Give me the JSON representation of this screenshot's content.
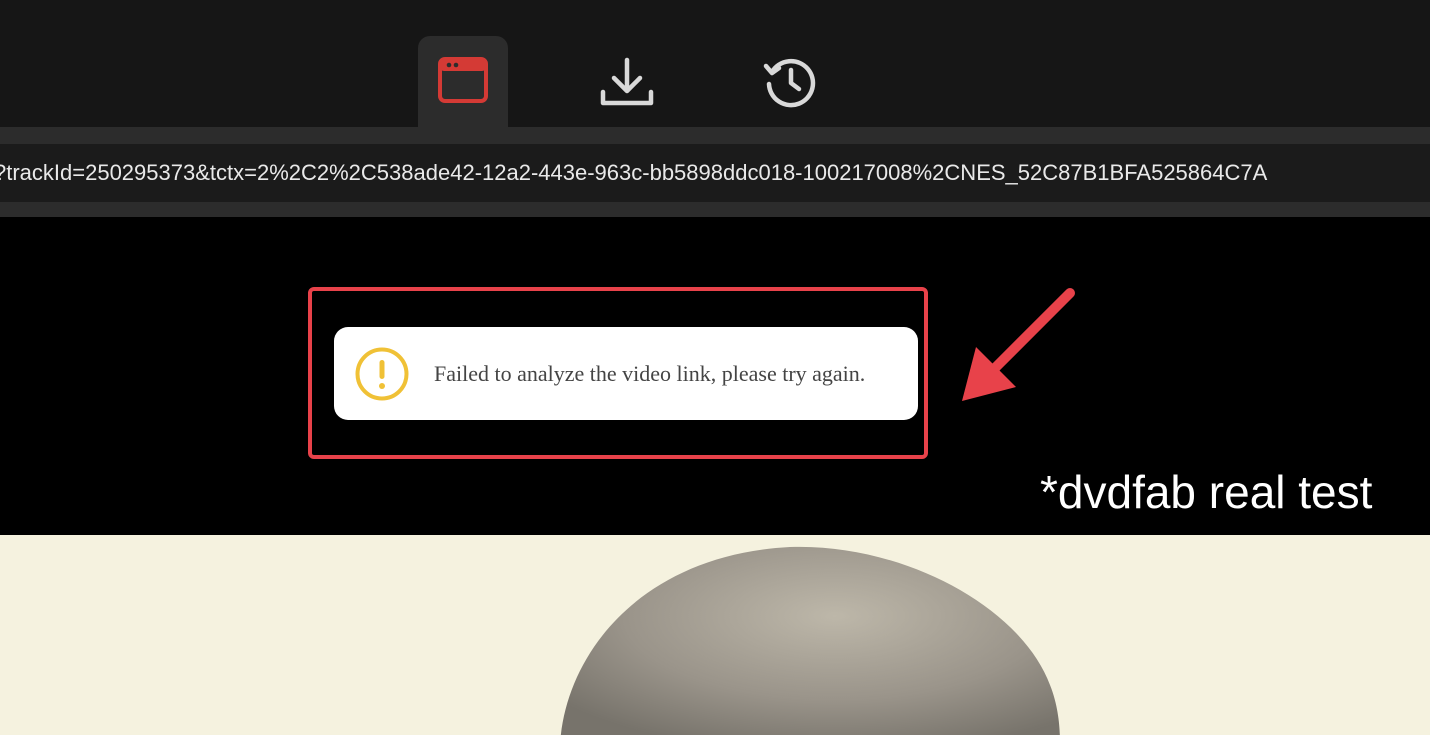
{
  "tabs": [
    {
      "icon": "browser-window-icon",
      "active": true
    },
    {
      "icon": "download-icon",
      "active": false
    },
    {
      "icon": "history-icon",
      "active": false
    }
  ],
  "address_bar": {
    "url": "?trackId=250295373&tctx=2%2C2%2C538ade42-12a2-443e-963c-bb5898ddc018-100217008%2CNES_52C87B1BFA525864C7A"
  },
  "toast": {
    "icon": "warning-icon",
    "message": "Failed to analyze the video link, please try again."
  },
  "annotation": {
    "caption": "*dvdfab real test"
  },
  "colors": {
    "accent_red": "#e8424a",
    "warning_yellow": "#f0c136",
    "active_tab_icon": "#d43a35"
  }
}
